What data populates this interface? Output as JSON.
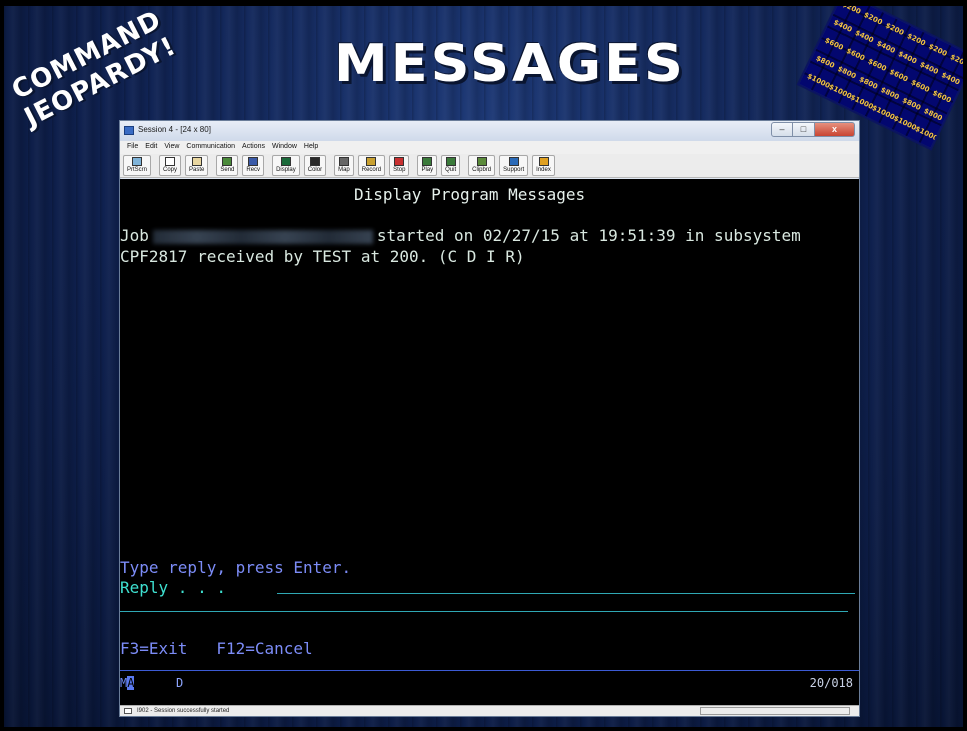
{
  "slide": {
    "title": "MESSAGES",
    "corner_line1": "COMMAND",
    "corner_line2": "JEOPARDY!",
    "board_values": [
      "$200",
      "$400",
      "$600",
      "$800",
      "$1000"
    ]
  },
  "window": {
    "title": "Session 4 - [24 x 80]",
    "minimize": "–",
    "maximize": "□",
    "close": "x",
    "menus": [
      "File",
      "Edit",
      "View",
      "Communication",
      "Actions",
      "Window",
      "Help"
    ],
    "toolbar": [
      "PrtScrn",
      "Copy",
      "Paste",
      "Send",
      "Recv",
      "Display",
      "Color",
      "Map",
      "Record",
      "Stop",
      "Play",
      "Quit",
      "Clipbrd",
      "Support",
      "Index"
    ]
  },
  "screen": {
    "header": "Display Program Messages",
    "job_prefix": "Job",
    "job_suffix": "started on 02/27/15 at 19:51:39 in subsystem",
    "message": "CPF2817 received by TEST at 200. (C D I R)",
    "prompt": "Type reply, press Enter.",
    "reply_label": "Reply . . .",
    "reply_value": "",
    "fkeys": "F3=Exit   F12=Cancel"
  },
  "oia": {
    "ma_text": "M",
    "ma_cursor": "A",
    "mode": "D",
    "cursor_pos": "20/018"
  },
  "status": {
    "text": "I902 - Session successfully started"
  },
  "colors": {
    "screen_bg": "#000000",
    "field_green": "#d9e8e0",
    "prompt_blue": "#7c8cf7",
    "input_turquoise": "#3ee0d0"
  }
}
